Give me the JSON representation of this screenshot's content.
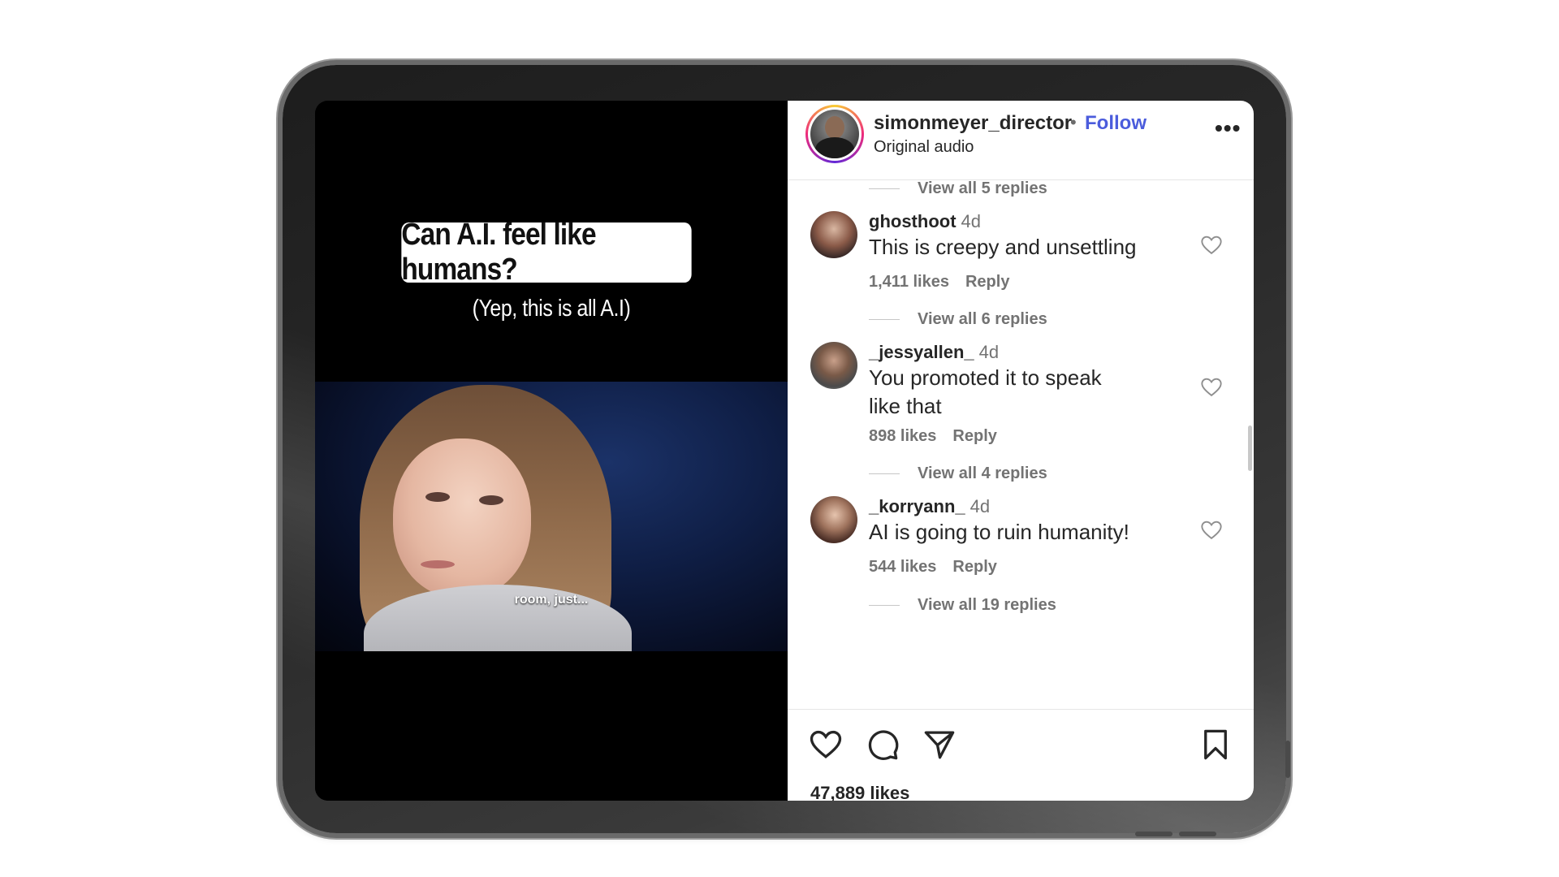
{
  "video": {
    "caption_title": "Can A.I. feel like humans?",
    "caption_subtitle": "(Yep, this is all A.I)",
    "subtitle_text": "room, just..."
  },
  "post": {
    "username": "simonmeyer_director",
    "separator": "•",
    "follow_label": "Follow",
    "audio_label": "Original audio",
    "more_label": "•••",
    "likes_text": "47,889 likes"
  },
  "comments": [
    {
      "replies_before": "View all 5 replies",
      "username": "ghosthoot",
      "time": "4d",
      "text": "This is creepy and unsettling",
      "likes": "1,411 likes",
      "reply_label": "Reply"
    },
    {
      "replies_before": "View all 6 replies",
      "username": "_jessyallen_",
      "time": "4d",
      "text": "You promoted it to speak like that",
      "likes": "898 likes",
      "reply_label": "Reply"
    },
    {
      "replies_before": "View all 4 replies",
      "username": "_korryann_",
      "time": "4d",
      "text": "AI is going to ruin humanity!",
      "likes": "544 likes",
      "reply_label": "Reply"
    }
  ],
  "trailing_replies": "View all 19 replies",
  "icons": {
    "like": "heart-icon",
    "comment": "comment-icon",
    "share": "share-icon",
    "save": "bookmark-icon",
    "comment_like": "heart-icon"
  },
  "colors": {
    "follow": "#4b5cdc",
    "muted_text": "#737373",
    "primary_text": "#262626"
  }
}
